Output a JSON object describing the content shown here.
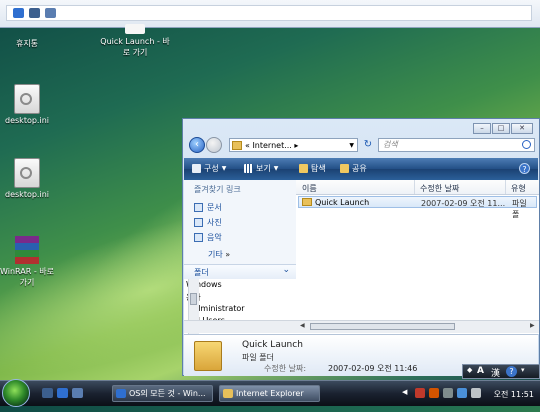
{
  "desktop": {
    "icons": [
      {
        "label": "휴지통",
        "icon": "recycle-bin-icon"
      },
      {
        "label": "Quick Launch - 바로 가기",
        "icon": "folder-shortcut-icon"
      },
      {
        "label": "desktop.ini",
        "icon": "settings-file-icon"
      },
      {
        "label": "desktop.ini",
        "icon": "settings-file-icon"
      },
      {
        "label": "WinRAR - 바로 가기",
        "icon": "winrar-icon"
      }
    ]
  },
  "explorer": {
    "address": "« Internet... ▸",
    "search_placeholder": "검색",
    "toolbar": {
      "organize": "구성",
      "views": "보기",
      "explore": "탐색",
      "share": "공유",
      "help": "?"
    },
    "favorites_header": "즐겨찾기 링크",
    "favorites": [
      "문서",
      "사진",
      "음악"
    ],
    "more": "기타",
    "more_arrows": "»",
    "folders_label": "폴더",
    "tree": [
      "Windows",
      "용자",
      "Administrator",
      "All Users"
    ],
    "columns": [
      "이름",
      "수정한 날짜",
      "유형"
    ],
    "rows": [
      {
        "name": "Quick Launch",
        "modified": "2007-02-09 오전 11...",
        "type": "파일 폴"
      }
    ],
    "details": {
      "name": "Quick Launch",
      "type": "파일 폴더",
      "modified_label": "수정한 날짜:",
      "modified_value": "2007-02-09 오전 11:46"
    }
  },
  "taskbar": {
    "tasks": [
      "OS의 모든 것 - Win...",
      "Internet Explorer"
    ],
    "clock": "오전 11:51"
  },
  "langbar": {
    "mode": "A",
    "hanja": "漢",
    "help": "?"
  },
  "colors": {
    "accent": "#234f86",
    "link": "#1a4f9c",
    "folder": "#e8c05a"
  }
}
